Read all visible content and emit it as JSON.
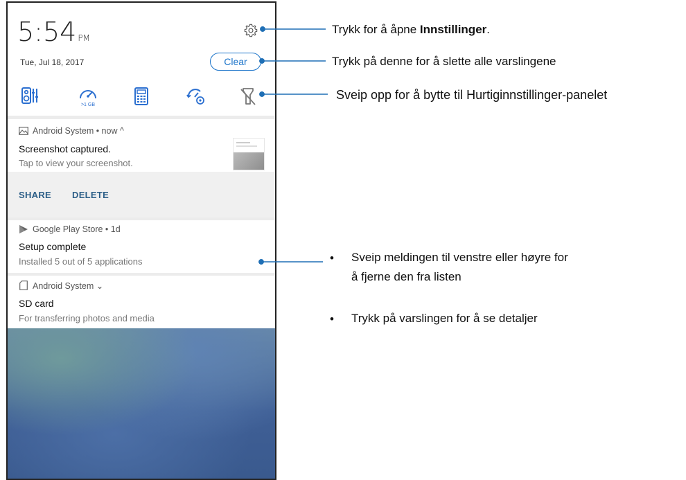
{
  "status": {
    "time": "5:54",
    "ampm": "PM",
    "date": "Tue, Jul 18, 2017",
    "clear_label": "Clear",
    "data_icon_label": ">1 GB"
  },
  "quick_settings": [
    {
      "icon": "audio-wizard-icon"
    },
    {
      "icon": "data-usage-icon"
    },
    {
      "icon": "calculator-icon"
    },
    {
      "icon": "boost-icon"
    },
    {
      "icon": "flashlight-off-icon"
    }
  ],
  "notifications": [
    {
      "app": "Android System • now ^",
      "title": "Screenshot captured.",
      "text": "Tap to view your screenshot.",
      "actions": [
        "SHARE",
        "DELETE"
      ]
    },
    {
      "app": "Google Play Store • 1d",
      "title": "Setup complete",
      "text": "Installed 5 out of 5 applications"
    },
    {
      "app": "Android System ⌄",
      "title": "SD card",
      "text": "For transferring photos and media"
    }
  ],
  "callouts": {
    "settings_pre": "Trykk for å åpne ",
    "settings_bold": "Innstillinger",
    "settings_post": ".",
    "clear": "Trykk på denne for å slette alle varslingene",
    "quick": "Sveip opp for å bytte til Hurtiginnstillinger-panelet",
    "swipe_line1": "Sveip meldingen til venstre eller høyre for",
    "swipe_line2": "å fjerne den fra listen",
    "tap": "Trykk på varslingen for å se detaljer",
    "bullet": "•"
  },
  "colors": {
    "accent": "#1a73c9",
    "icon_blue": "#2b6fd0",
    "action_text": "#2d5f88"
  }
}
